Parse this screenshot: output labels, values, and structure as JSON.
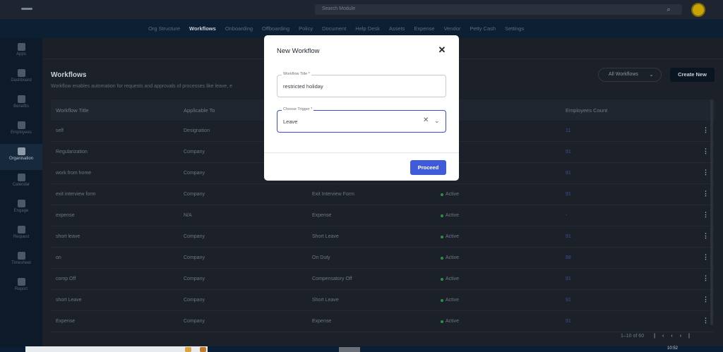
{
  "topbar": {
    "search_placeholder": "Search Module"
  },
  "nav": {
    "links": [
      "Org Structure",
      "Workflows",
      "Onboarding",
      "Offboarding",
      "Policy",
      "Document",
      "Help Desk",
      "Assets",
      "Expense",
      "Vendor",
      "Petty Cash",
      "Settings"
    ],
    "active": "Workflows"
  },
  "sidebar": {
    "items": [
      "Apps",
      "Dashboard",
      "Benefits",
      "Employees",
      "Organisation",
      "Calendar",
      "Engage",
      "Request",
      "Timesheet",
      "Report"
    ],
    "active": "Organisation"
  },
  "page": {
    "title": "Workflows",
    "subtitle": "Workflow enables automation for requests and approvals of processes like leave, e",
    "filter_label": "All Workflows",
    "create_label": "Create New"
  },
  "table": {
    "headers": [
      "Workflow Title",
      "Applicable To",
      "",
      "",
      "Employees Count"
    ],
    "rows": [
      [
        "self",
        "Designation",
        "",
        "",
        "11"
      ],
      [
        "Regularization",
        "Company",
        "",
        "",
        "91"
      ],
      [
        "work from home",
        "Company",
        "",
        "",
        "91"
      ],
      [
        "exit interview form",
        "Company",
        "Exit Interview Form",
        "Active",
        "91"
      ],
      [
        "expense",
        "N/A",
        "Expense",
        "Active",
        "-"
      ],
      [
        "short leave",
        "Company",
        "Short Leave",
        "Active",
        "91"
      ],
      [
        "on",
        "Company",
        "On Duty",
        "Active",
        "88"
      ],
      [
        "comp Off",
        "Company",
        "Compensatory Off",
        "Active",
        "91"
      ],
      [
        "short Leave",
        "Company",
        "Short Leave",
        "Active",
        "91"
      ],
      [
        "Expense",
        "Company",
        "Expense",
        "Active",
        "91"
      ]
    ],
    "pagination": "1–10 of 60"
  },
  "modal": {
    "title": "New Workflow",
    "workflow_title_label": "Workflow Title *",
    "workflow_title_value": "restricted holiday",
    "trigger_label": "Choose Trigger *",
    "trigger_value": "Leave",
    "proceed_label": "Proceed"
  },
  "taskbar": {
    "clock": "10:52"
  },
  "colors": {
    "accent": "#3f5bd9",
    "overlay": "#1c2129",
    "active_dot": "#2f8f4a"
  }
}
